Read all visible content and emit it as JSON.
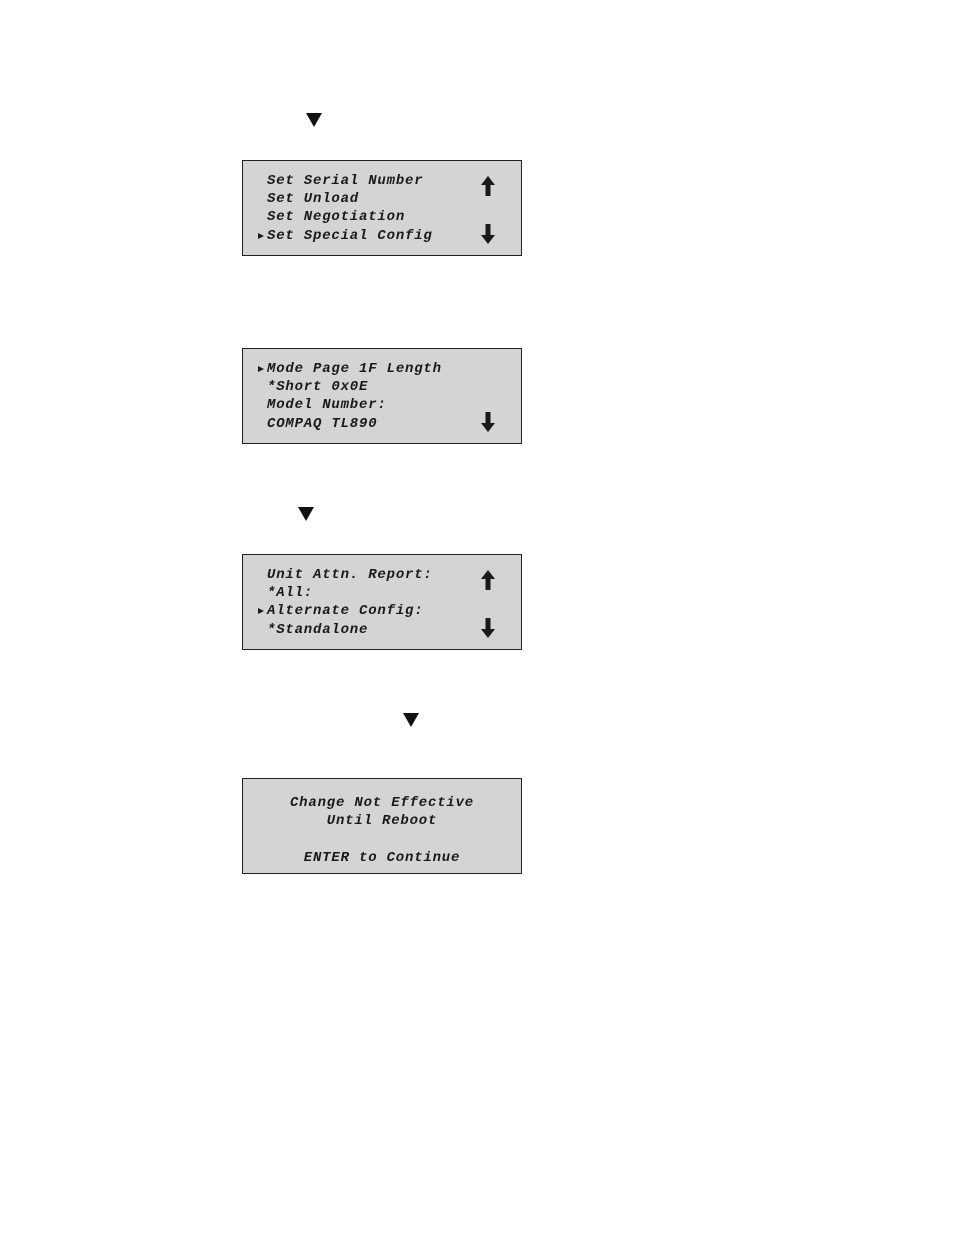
{
  "screens": [
    {
      "lines": [
        "Set Serial Number",
        "Set Unload",
        "Set Negotiation",
        "Set Special Config"
      ],
      "selected_line": 4,
      "scroll_up": true,
      "scroll_down": true
    },
    {
      "lines": [
        "Mode Page 1F Length",
        "*Short 0x0E",
        "Model Number:",
        "COMPAQ TL890"
      ],
      "selected_line": 1,
      "scroll_up": false,
      "scroll_down": true
    },
    {
      "lines": [
        "Unit Attn. Report:",
        "*All:",
        "Alternate Config:",
        "*Standalone"
      ],
      "selected_line": 3,
      "scroll_up": true,
      "scroll_down": true
    },
    {
      "lines": [
        "Change Not Effective",
        "Until Reboot",
        "",
        "ENTER to Continue"
      ],
      "centered": true
    }
  ],
  "icons": {
    "step": "down-triangle-icon",
    "up": "arrow-up-icon",
    "down": "arrow-down-icon",
    "selector": "selection-pointer-icon"
  },
  "colors": {
    "lcd_background": "#d4d4d4",
    "text": "#1a1a1a"
  }
}
